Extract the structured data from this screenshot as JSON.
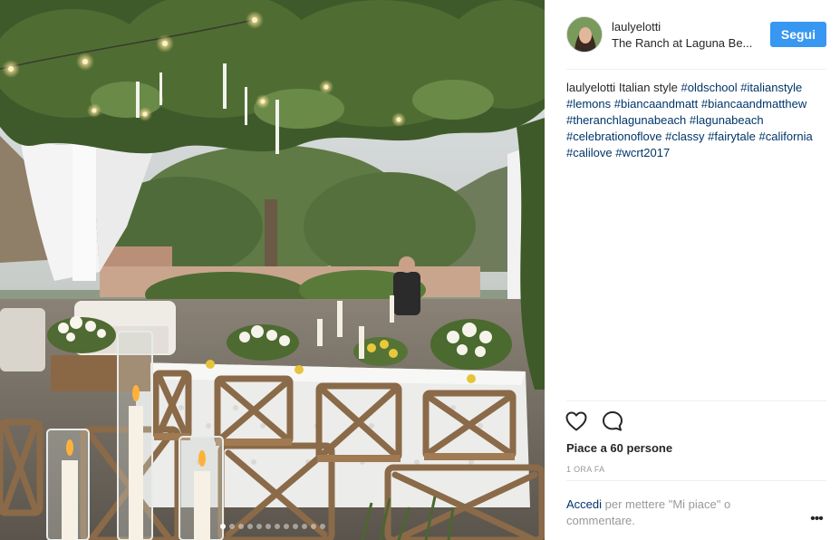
{
  "post": {
    "photo_alt": "",
    "carousel": {
      "total": 12,
      "active_index": 0
    }
  },
  "header": {
    "username": "laulyelotti",
    "location": "The Ranch at Laguna Be...",
    "follow_label": "Segui"
  },
  "caption": {
    "username": "laulyelotti",
    "text": "Italian style",
    "hashtags": [
      "#oldschool",
      "#italianstyle",
      "#lemons",
      "#biancaandmatt",
      "#biancaandmatthew",
      "#theranchlagunabeach",
      "#lagunabeach",
      "#celebrationoflove",
      "#classy",
      "#fairytale",
      "#california",
      "#calilove",
      "#wcrt2017"
    ]
  },
  "actions": {
    "like_icon": "heart-icon",
    "comment_icon": "comment-icon"
  },
  "likes_text": "Piace a 60 persone",
  "time_text": "1 ORA FA",
  "login": {
    "link": "Accedi",
    "rest": "per mettere \"Mi piace\" o commentare."
  },
  "more_label": "•••",
  "colors": {
    "accent": "#3897f0",
    "link": "#003569",
    "muted": "#999999"
  }
}
